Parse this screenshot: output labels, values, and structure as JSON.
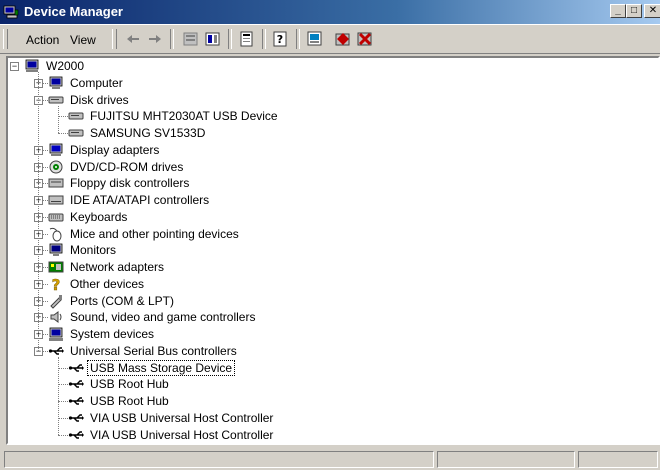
{
  "window": {
    "title": "Device Manager",
    "minimize": "_",
    "maximize": "□",
    "close": "✕"
  },
  "menu": {
    "action": "Action",
    "view": "View"
  },
  "toolbar_icons": [
    "back-arrow-icon",
    "forward-arrow-icon",
    "list-view-icon",
    "details-view-icon",
    "properties-icon",
    "help-icon",
    "scan-hardware-icon",
    "disable-device-icon",
    "uninstall-device-icon"
  ],
  "tree": {
    "root": "W2000",
    "items": [
      {
        "label": "Computer",
        "icon": "computer-icon"
      },
      {
        "label": "Disk drives",
        "icon": "disk-drive-icon",
        "children": [
          "FUJITSU MHT2030AT USB Device",
          "SAMSUNG SV1533D"
        ]
      },
      {
        "label": "Display adapters",
        "icon": "display-adapter-icon"
      },
      {
        "label": "DVD/CD-ROM drives",
        "icon": "cdrom-icon"
      },
      {
        "label": "Floppy disk controllers",
        "icon": "floppy-controller-icon"
      },
      {
        "label": "IDE ATA/ATAPI controllers",
        "icon": "ide-controller-icon"
      },
      {
        "label": "Keyboards",
        "icon": "keyboard-icon"
      },
      {
        "label": "Mice and other pointing devices",
        "icon": "mouse-icon"
      },
      {
        "label": "Monitors",
        "icon": "monitor-icon"
      },
      {
        "label": "Network adapters",
        "icon": "network-adapter-icon"
      },
      {
        "label": "Other devices",
        "icon": "question-mark-icon"
      },
      {
        "label": "Ports (COM & LPT)",
        "icon": "port-icon"
      },
      {
        "label": "Sound, video and game controllers",
        "icon": "sound-icon"
      },
      {
        "label": "System devices",
        "icon": "system-device-icon"
      },
      {
        "label": "Universal Serial Bus controllers",
        "icon": "usb-icon",
        "children": [
          "USB Mass Storage Device",
          "USB Root Hub",
          "USB Root Hub",
          "VIA USB Universal Host Controller",
          "VIA USB Universal Host Controller"
        ]
      }
    ],
    "selected": "USB Mass Storage Device"
  }
}
